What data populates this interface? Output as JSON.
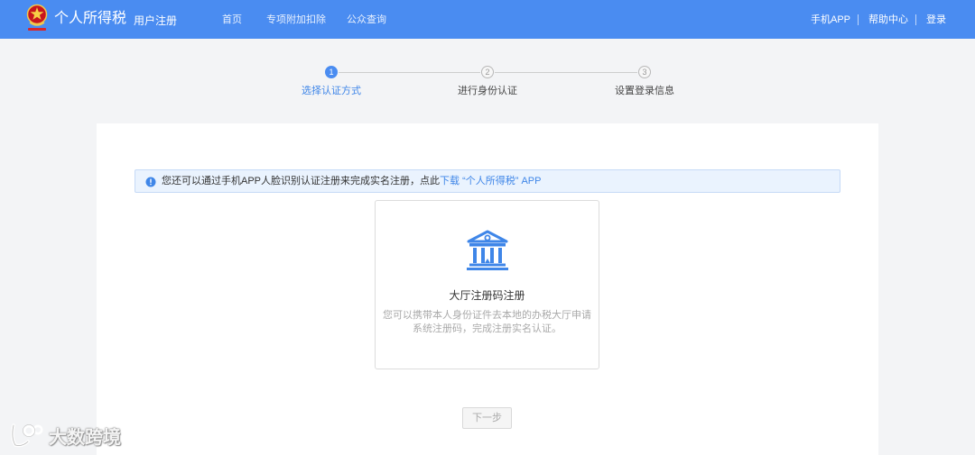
{
  "header": {
    "emblem_icon": "national-emblem-icon",
    "app_title": "个人所得税",
    "subtitle": "用户注册",
    "nav": [
      {
        "label": "首页"
      },
      {
        "label": "专项附加扣除"
      },
      {
        "label": "公众查询"
      }
    ],
    "right_links": [
      {
        "label": "手机APP"
      },
      {
        "label": "帮助中心"
      },
      {
        "label": "登录"
      }
    ]
  },
  "steps": [
    {
      "number": "1",
      "label": "选择认证方式",
      "active": true
    },
    {
      "number": "2",
      "label": "进行身份认证",
      "active": false
    },
    {
      "number": "3",
      "label": "设置登录信息",
      "active": false
    }
  ],
  "notice": {
    "icon": "info-icon",
    "text": "您还可以通过手机APP人脸识别认证注册来完成实名注册，点此",
    "link_text": "下载",
    "link_suffix": " “个人所得税” APP"
  },
  "option_card": {
    "icon": "bank-building-icon",
    "title": "大厅注册码注册",
    "description_lines": [
      "您可以携带本人身份证件去本地的办税大厅申请",
      "系统注册码，完成注册实名认证。"
    ]
  },
  "next_button": {
    "label": "下一步",
    "disabled": true
  },
  "watermark": {
    "icon": "watermark-logo-icon",
    "text": "大数跨境"
  },
  "colors": {
    "header_bg": "#4a8cf1",
    "primary": "#3f86e8",
    "page_bg": "#f3f4f6",
    "notice_bg": "#eaf3fe",
    "notice_border": "#c5daf6"
  }
}
